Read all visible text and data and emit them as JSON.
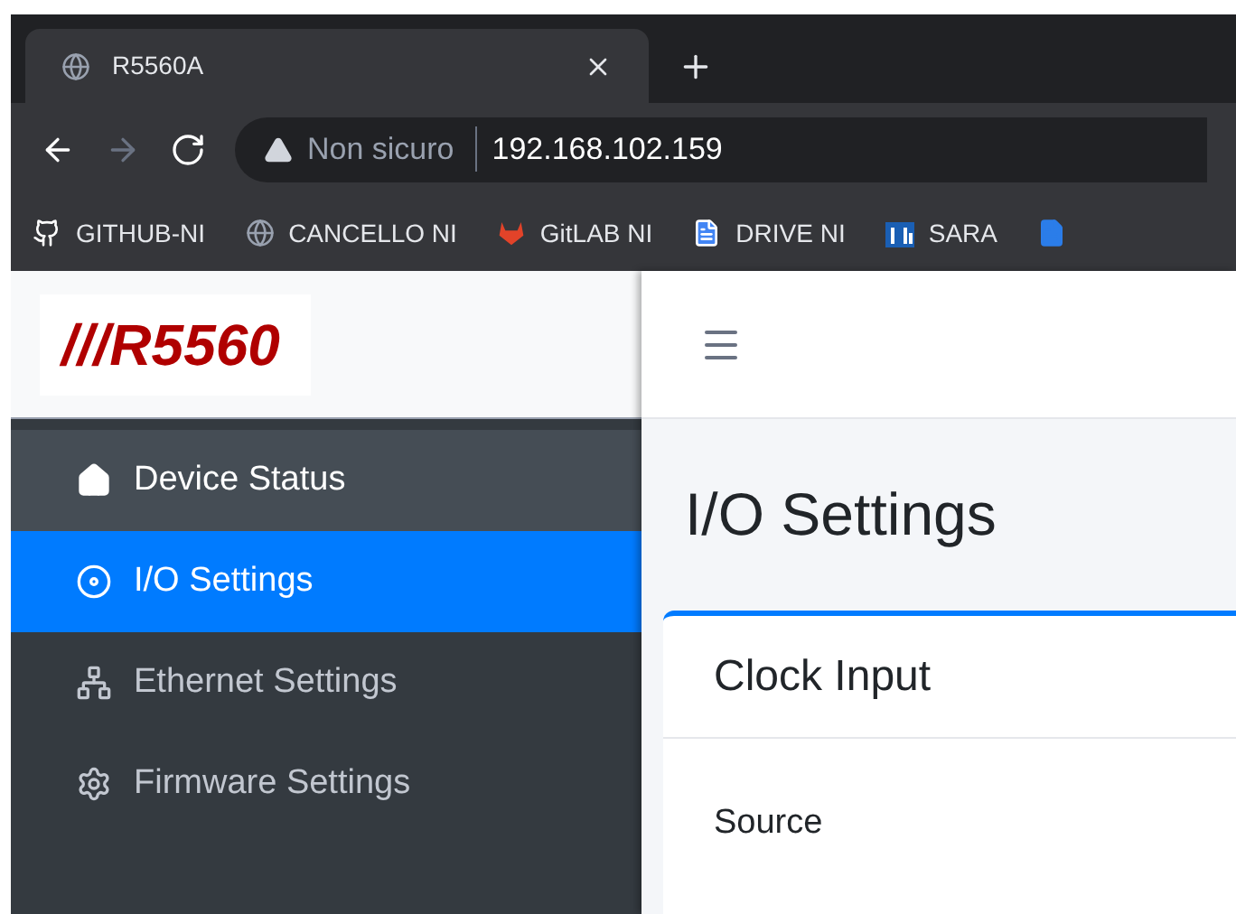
{
  "browser": {
    "tab": {
      "title": "R5560A"
    },
    "address": {
      "security_label": "Non sicuro",
      "url": "192.168.102.159"
    },
    "bookmarks": [
      {
        "kind": "github",
        "label": "GITHUB-NI"
      },
      {
        "kind": "globe",
        "label": "CANCELLO NI"
      },
      {
        "kind": "gitlab",
        "label": "GitLAB NI"
      },
      {
        "kind": "doc",
        "label": "DRIVE NI"
      },
      {
        "kind": "ni",
        "label": "SARA"
      }
    ]
  },
  "logo": {
    "text": "///R5560"
  },
  "sidebar": {
    "items": [
      {
        "kind": "home",
        "label": "Device Status",
        "selected": false,
        "hovered": true
      },
      {
        "kind": "disc",
        "label": "I/O Settings",
        "selected": true,
        "hovered": false
      },
      {
        "kind": "network",
        "label": "Ethernet Settings",
        "selected": false,
        "hovered": false
      },
      {
        "kind": "gear",
        "label": "Firmware Settings",
        "selected": false,
        "hovered": false
      }
    ]
  },
  "page_title": "I/O Settings",
  "card": {
    "title": "Clock Input",
    "fields": [
      {
        "label": "Source"
      }
    ]
  }
}
